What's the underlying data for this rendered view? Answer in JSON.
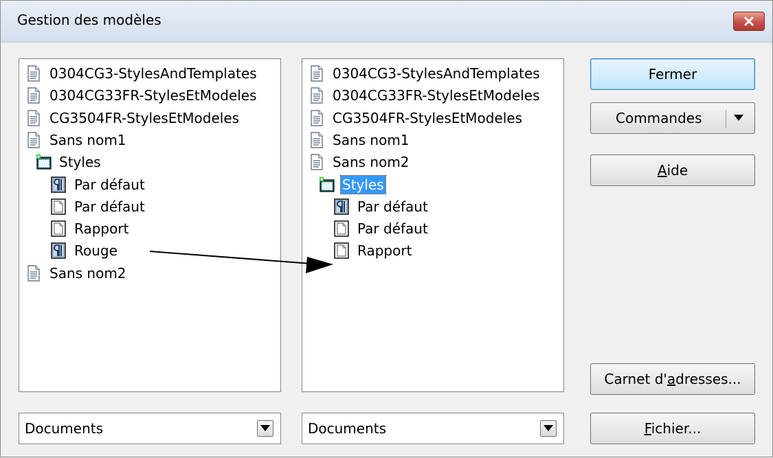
{
  "window": {
    "title": "Gestion des modèles"
  },
  "left_tree": [
    {
      "label": "0304CG3-StylesAndTemplates",
      "icon": "document-icon",
      "level": 0
    },
    {
      "label": "0304CG33FR-StylesEtModeles",
      "icon": "document-icon",
      "level": 0
    },
    {
      "label": "CG3504FR-StylesEtModeles",
      "icon": "document-icon",
      "level": 0
    },
    {
      "label": "Sans nom1",
      "icon": "document-icon",
      "level": 0
    },
    {
      "label": "Styles",
      "icon": "styles-folder-icon",
      "level": 1
    },
    {
      "label": "Par défaut",
      "icon": "paragraph-style-icon",
      "level": 2
    },
    {
      "label": "Par défaut",
      "icon": "page-style-icon",
      "level": 2
    },
    {
      "label": "Rapport",
      "icon": "page-style-icon",
      "level": 2
    },
    {
      "label": "Rouge",
      "icon": "paragraph-style-icon",
      "level": 2
    },
    {
      "label": "Sans nom2",
      "icon": "document-icon",
      "level": 0
    }
  ],
  "right_tree": [
    {
      "label": "0304CG3-StylesAndTemplates",
      "icon": "document-icon",
      "level": 0
    },
    {
      "label": "0304CG33FR-StylesEtModeles",
      "icon": "document-icon",
      "level": 0
    },
    {
      "label": "CG3504FR-StylesEtModeles",
      "icon": "document-icon",
      "level": 0
    },
    {
      "label": "Sans nom1",
      "icon": "document-icon",
      "level": 0
    },
    {
      "label": "Sans nom2",
      "icon": "document-icon",
      "level": 0
    },
    {
      "label": "Styles",
      "icon": "styles-folder-icon",
      "level": 1,
      "selected": true
    },
    {
      "label": "Par défaut",
      "icon": "paragraph-style-icon",
      "level": 2
    },
    {
      "label": "Par défaut",
      "icon": "page-style-icon",
      "level": 2
    },
    {
      "label": "Rapport",
      "icon": "page-style-icon",
      "level": 2
    }
  ],
  "buttons": {
    "close": "Fermer",
    "commands": "Commandes",
    "help_mnemonic": "A",
    "help_rest": "ide",
    "address_book_pre": "Carnet d'",
    "address_book_mnemonic": "a",
    "address_book_post": "dresses...",
    "file_mnemonic": "F",
    "file_rest": "ichier..."
  },
  "left_combo": {
    "value": "Documents"
  },
  "right_combo": {
    "value": "Documents"
  },
  "colors": {
    "selection": "#3399ff",
    "close_button": "#c75050"
  }
}
